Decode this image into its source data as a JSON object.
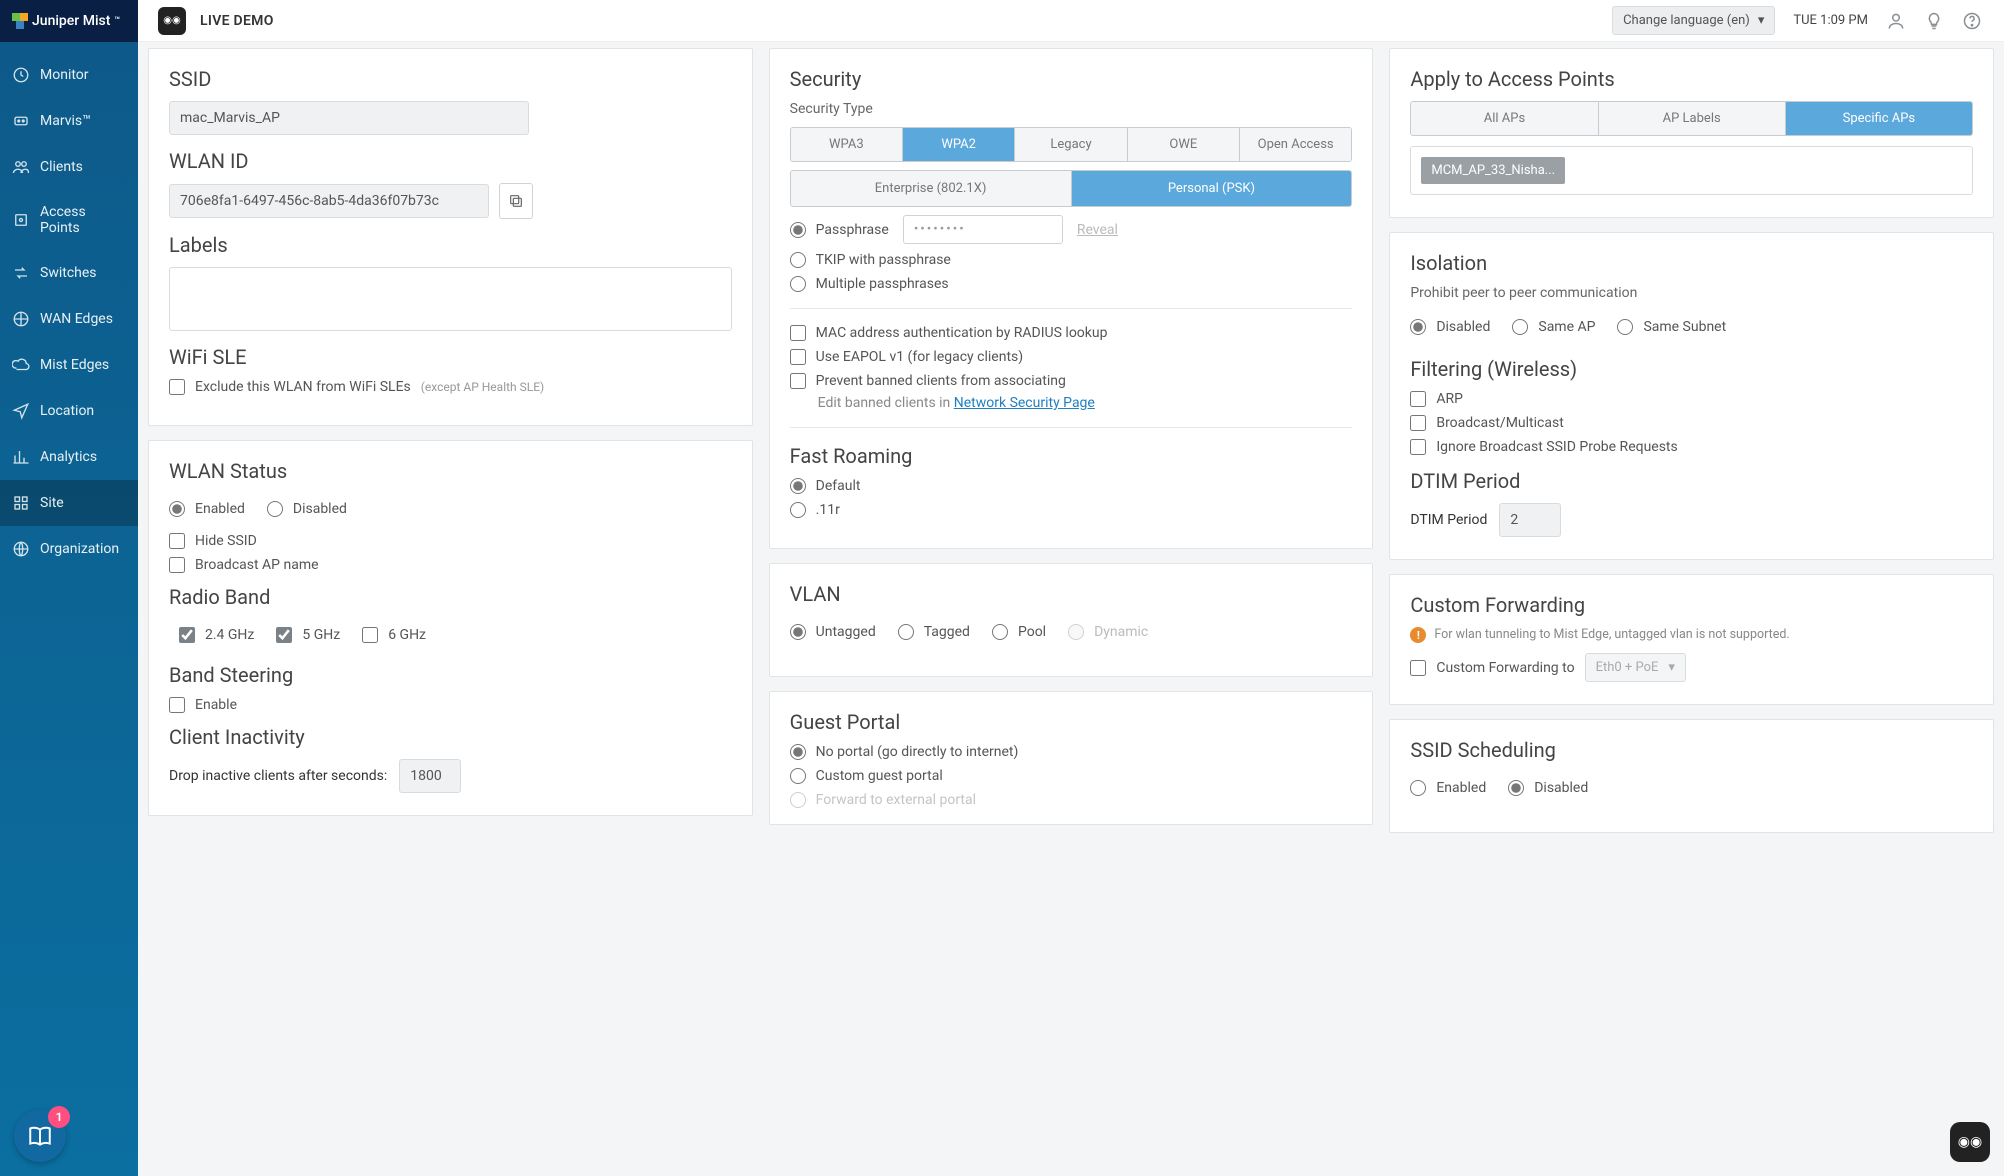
{
  "topbar": {
    "brand": "Juniper Mist",
    "demo": "LIVE DEMO",
    "lang": "Change language (en)",
    "time": "TUE 1:09 PM"
  },
  "nav": {
    "items": [
      {
        "label": "Monitor"
      },
      {
        "label": "Marvis™"
      },
      {
        "label": "Clients"
      },
      {
        "label": "Access Points"
      },
      {
        "label": "Switches"
      },
      {
        "label": "WAN Edges"
      },
      {
        "label": "Mist Edges"
      },
      {
        "label": "Location"
      },
      {
        "label": "Analytics"
      },
      {
        "label": "Site"
      },
      {
        "label": "Organization"
      }
    ],
    "help_badge": "1"
  },
  "col1": {
    "ssid_label": "SSID",
    "ssid_value": "mac_Marvis_AP",
    "wlan_id_label": "WLAN ID",
    "wlan_id_value": "706e8fa1-6497-456c-8ab5-4da36f07b73c",
    "labels_label": "Labels",
    "wsle_title": "WiFi SLE",
    "wsle_check": "Exclude this WLAN from WiFi SLEs",
    "wsle_note": "(except AP Health SLE)",
    "status_title": "WLAN Status",
    "status_enabled": "Enabled",
    "status_disabled": "Disabled",
    "hide_ssid": "Hide SSID",
    "broadcast_ap": "Broadcast AP name",
    "radio_title": "Radio Band",
    "band24": "2.4 GHz",
    "band5": "5 GHz",
    "band6": "6 GHz",
    "steer_title": "Band Steering",
    "steer_enable": "Enable",
    "inact_title": "Client Inactivity",
    "inact_label": "Drop inactive clients after seconds:",
    "inact_value": "1800"
  },
  "col2": {
    "sec_title": "Security",
    "sec_type": "Security Type",
    "wpa3": "WPA3",
    "wpa2": "WPA2",
    "legacy": "Legacy",
    "owe": "OWE",
    "open": "Open Access",
    "ent": "Enterprise (802.1X)",
    "psk": "Personal (PSK)",
    "pass_label": "Passphrase",
    "pass_mask": "••••••••",
    "reveal": "Reveal",
    "tkip": "TKIP with passphrase",
    "multi": "Multiple passphrases",
    "mac_auth": "MAC address authentication by RADIUS lookup",
    "eapol": "Use EAPOL v1 (for legacy clients)",
    "banned": "Prevent banned clients from associating",
    "banned_note": "Edit banned clients in ",
    "banned_link": "Network Security Page",
    "roam_title": "Fast Roaming",
    "roam_default": "Default",
    "roam_11r": ".11r",
    "vlan_title": "VLAN",
    "vlan_untagged": "Untagged",
    "vlan_tagged": "Tagged",
    "vlan_pool": "Pool",
    "vlan_dynamic": "Dynamic",
    "gp_title": "Guest Portal",
    "gp_none": "No portal (go directly to internet)",
    "gp_custom": "Custom guest portal",
    "gp_forward": "Forward to external portal"
  },
  "col3": {
    "apply_title": "Apply to Access Points",
    "all": "All APs",
    "aplabels": "AP Labels",
    "specific": "Specific APs",
    "chip": "MCM_AP_33_Nisha...",
    "iso_title": "Isolation",
    "iso_sub": "Prohibit peer to peer communication",
    "iso_disabled": "Disabled",
    "iso_same_ap": "Same AP",
    "iso_same_sub": "Same Subnet",
    "filter_title": "Filtering (Wireless)",
    "arp": "ARP",
    "bcast": "Broadcast/Multicast",
    "ignore": "Ignore Broadcast SSID Probe Requests",
    "dtim_title": "DTIM Period",
    "dtim_label": "DTIM Period",
    "dtim_value": "2",
    "fwd_title": "Custom Forwarding",
    "fwd_warn": "For wlan tunneling to Mist Edge, untagged vlan is not supported.",
    "fwd_check": "Custom Forwarding to",
    "fwd_sel": "Eth0 + PoE",
    "sched_title": "SSID Scheduling",
    "sched_enabled": "Enabled",
    "sched_disabled": "Disabled"
  }
}
